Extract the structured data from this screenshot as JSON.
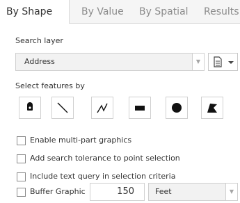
{
  "tabs": [
    {
      "label": "By Shape",
      "active": true
    },
    {
      "label": "By Value",
      "active": false
    },
    {
      "label": "By Spatial",
      "active": false
    },
    {
      "label": "Results",
      "active": false
    }
  ],
  "search_layer": {
    "label": "Search layer",
    "selected": "Address",
    "menu_icon": "document-list-icon"
  },
  "select_features": {
    "label": "Select features by",
    "tools": [
      {
        "name": "point-icon"
      },
      {
        "name": "line-icon"
      },
      {
        "name": "polyline-icon"
      },
      {
        "name": "extent-rectangle-icon"
      },
      {
        "name": "circle-icon"
      },
      {
        "name": "polygon-icon"
      }
    ]
  },
  "options": [
    {
      "label": "Enable multi-part graphics",
      "checked": false
    },
    {
      "label": "Add search tolerance to point selection",
      "checked": false
    },
    {
      "label": "Include text query in selection criteria",
      "checked": false
    }
  ],
  "buffer": {
    "label": "Buffer Graphic",
    "checked": false,
    "distance": "150",
    "unit": "Feet"
  }
}
